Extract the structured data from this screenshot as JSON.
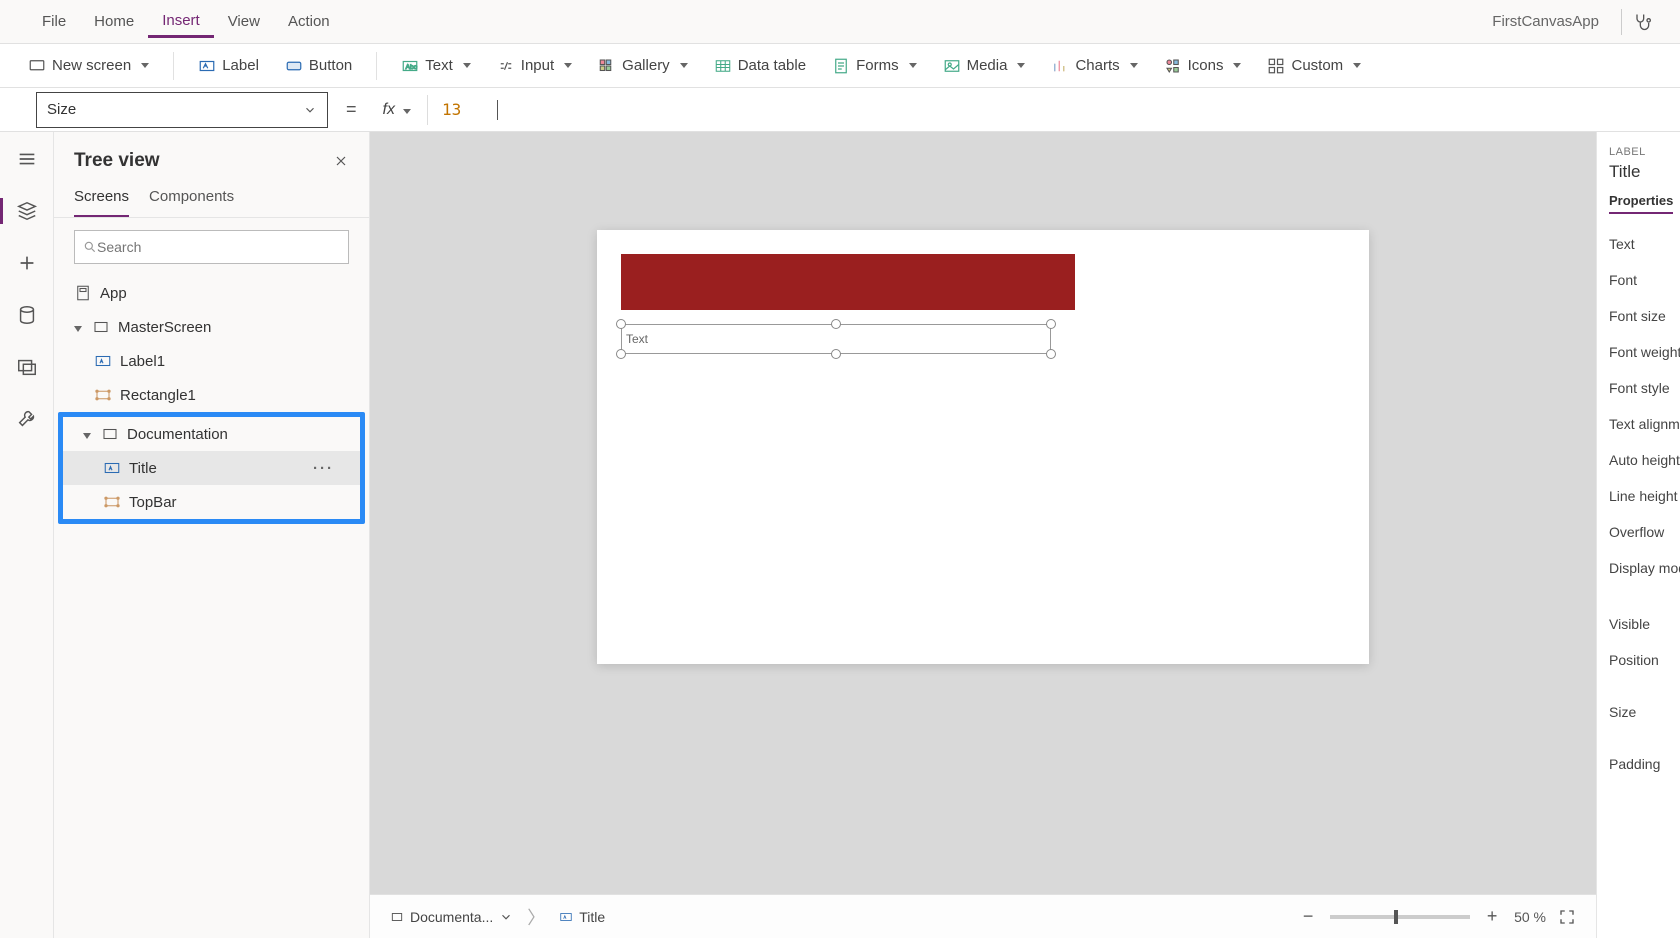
{
  "menubar": {
    "items": [
      "File",
      "Home",
      "Insert",
      "View",
      "Action"
    ],
    "activeIndex": 2,
    "appName": "FirstCanvasApp"
  },
  "ribbon": {
    "newScreen": "New screen",
    "label": "Label",
    "button": "Button",
    "text": "Text",
    "input": "Input",
    "gallery": "Gallery",
    "dataTable": "Data table",
    "forms": "Forms",
    "media": "Media",
    "charts": "Charts",
    "icons": "Icons",
    "custom": "Custom"
  },
  "formulaBar": {
    "property": "Size",
    "value": "13"
  },
  "treeView": {
    "title": "Tree view",
    "tabs": [
      "Screens",
      "Components"
    ],
    "activeTab": 0,
    "searchPlaceholder": "Search",
    "app": "App",
    "masterScreen": "MasterScreen",
    "label1": "Label1",
    "rectangle1": "Rectangle1",
    "documentation": "Documentation",
    "title_item": "Title",
    "topbar_item": "TopBar"
  },
  "canvas": {
    "selectedLabelText": "Text"
  },
  "breadcrumb": {
    "screen": "Documenta...",
    "control": "Title"
  },
  "zoom": {
    "value": "50",
    "unit": "%"
  },
  "propsPanel": {
    "type": "LABEL",
    "name": "Title",
    "tab": "Properties",
    "rows": [
      "Text",
      "Font",
      "Font size",
      "Font weight",
      "Font style",
      "Text alignme",
      "Auto height",
      "Line height",
      "Overflow",
      "Display mod",
      "Visible",
      "Position",
      "Size",
      "Padding"
    ]
  }
}
